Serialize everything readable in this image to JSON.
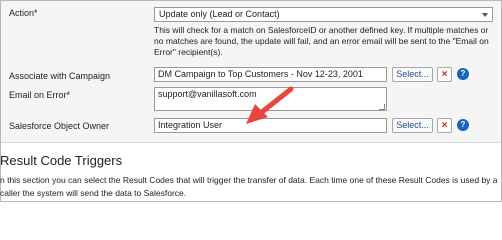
{
  "action": {
    "label": "Action*",
    "selected": "Update only (Lead or Contact)",
    "description": "This will check for a match on SalesforceID or another defined key. If multiple matches or no matches are found, the update will fail, and an error email will be sent to the \"Email on Error\" recipient(s)."
  },
  "campaign": {
    "label": "Associate with Campaign",
    "value": "DM Campaign to Top Customers - Nov 12-23, 2001",
    "select_label": "Select...",
    "remove_label": "×",
    "help_label": "?"
  },
  "email_error": {
    "label": "Email on Error*",
    "value": "support@vanillasoft.com"
  },
  "owner": {
    "label": "Salesforce Object Owner",
    "value": "Integration User",
    "select_label": "Select...",
    "remove_label": "×",
    "help_label": "?"
  },
  "result_triggers": {
    "title": "Result Code Triggers",
    "text": "n this section you can select the Result Codes that will trigger the transfer of data. Each time one of these Result Codes is used by a caller the system will send the data to Salesforce."
  },
  "colors": {
    "arrow": "#e8453c",
    "help_blue": "#1565c0",
    "remove_red": "#d82020",
    "panel_bg": "#f5f5f5"
  }
}
